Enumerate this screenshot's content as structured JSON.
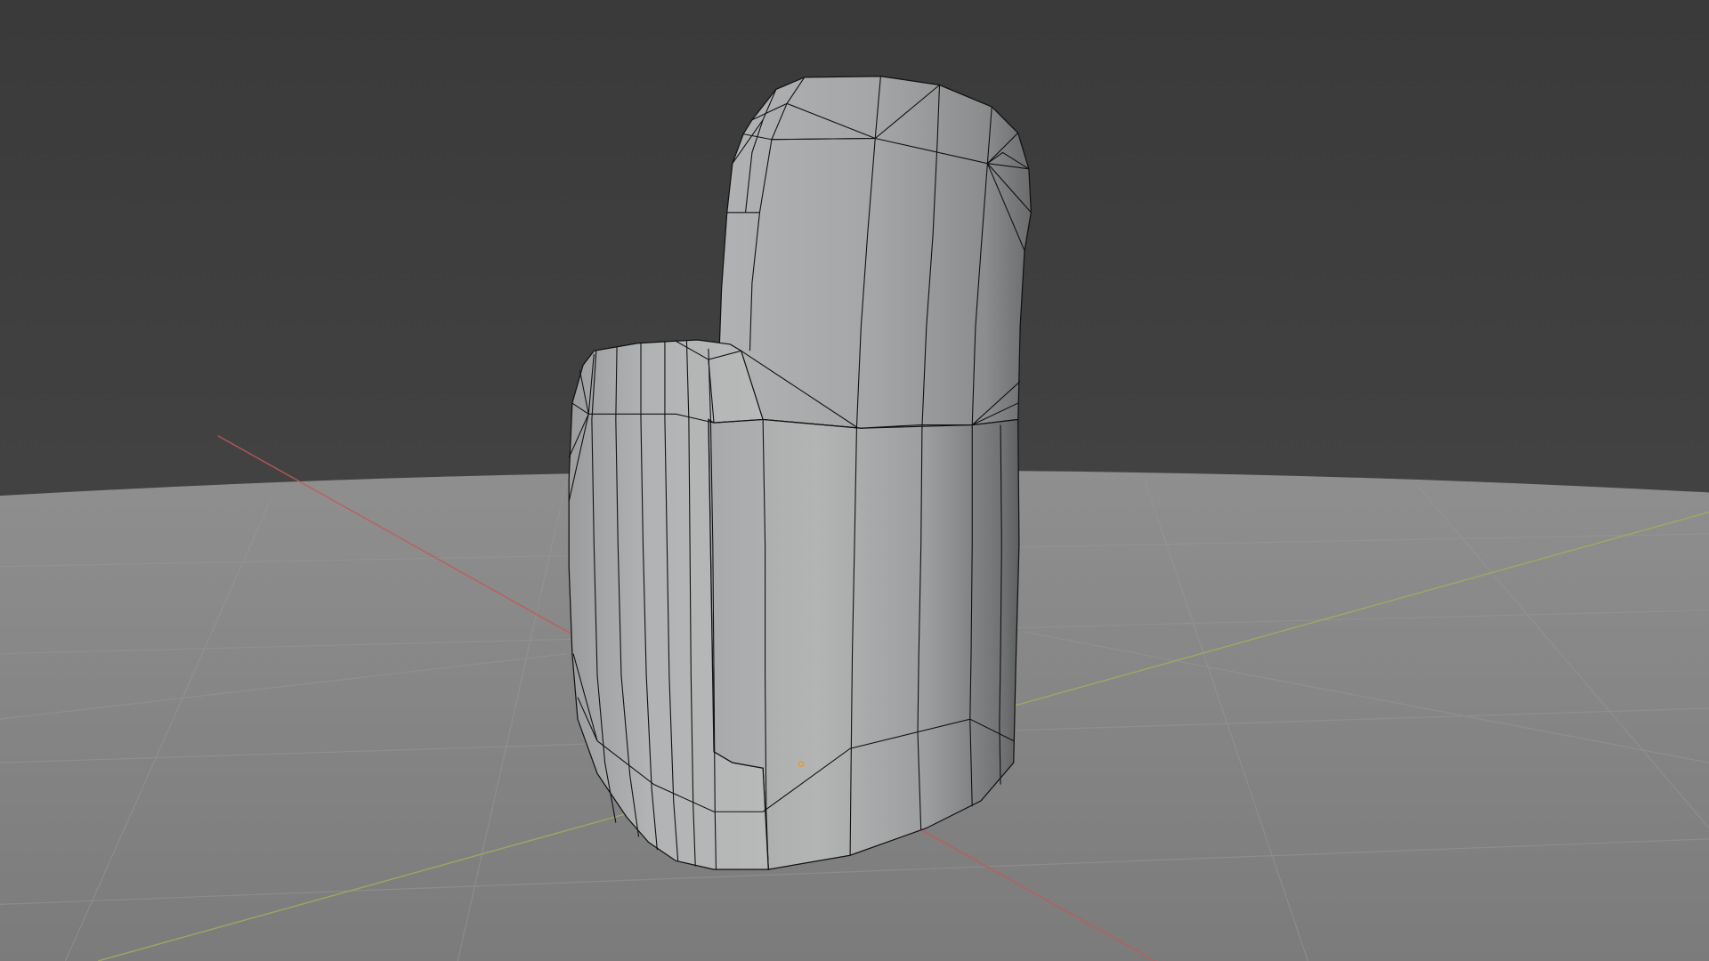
{
  "app": {
    "type": "3d-viewport",
    "shading_mode": "solid-with-wireframe",
    "view": "perspective"
  },
  "colors": {
    "background_top": "#3a3a3a",
    "background_horizon": "#4b4b4b",
    "floor": "#8a8a8a",
    "floor_near": "#7d7d7d",
    "grid_line": "#9a9a9a",
    "axis_x": "#c0504d",
    "axis_y": "#9aa85a",
    "mesh_light": "#b4b6b6",
    "mesh_mid": "#9fa1a2",
    "mesh_dark": "#6e7071",
    "wire": "#111111",
    "origin": "#e69a2e"
  },
  "scene": {
    "objects": [
      {
        "name": "mesh-object",
        "kind": "mesh",
        "selected": false
      }
    ],
    "origin_marker_visible": true,
    "grid_floor_visible": true,
    "axis_lines_visible": [
      "x",
      "y"
    ]
  }
}
